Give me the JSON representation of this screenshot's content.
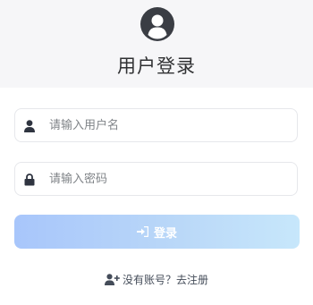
{
  "header": {
    "title": "用户登录",
    "avatar_icon": "user-circle-icon"
  },
  "form": {
    "username": {
      "placeholder": "请输入用户名",
      "value": "",
      "icon": "user-icon"
    },
    "password": {
      "placeholder": "请输入密码",
      "value": "",
      "icon": "lock-icon"
    },
    "login_button": {
      "label": "登录",
      "icon": "sign-in-icon"
    }
  },
  "register": {
    "text": "没有账号？去注册",
    "icon": "user-plus-icon"
  },
  "colors": {
    "header_bg": "#f6f6f8",
    "avatar": "#3a3d44",
    "button_gradient_start": "#a8c6fb",
    "button_gradient_end": "#c7e7fb",
    "field_border": "#e6e7eb",
    "text_dark": "#303133"
  }
}
